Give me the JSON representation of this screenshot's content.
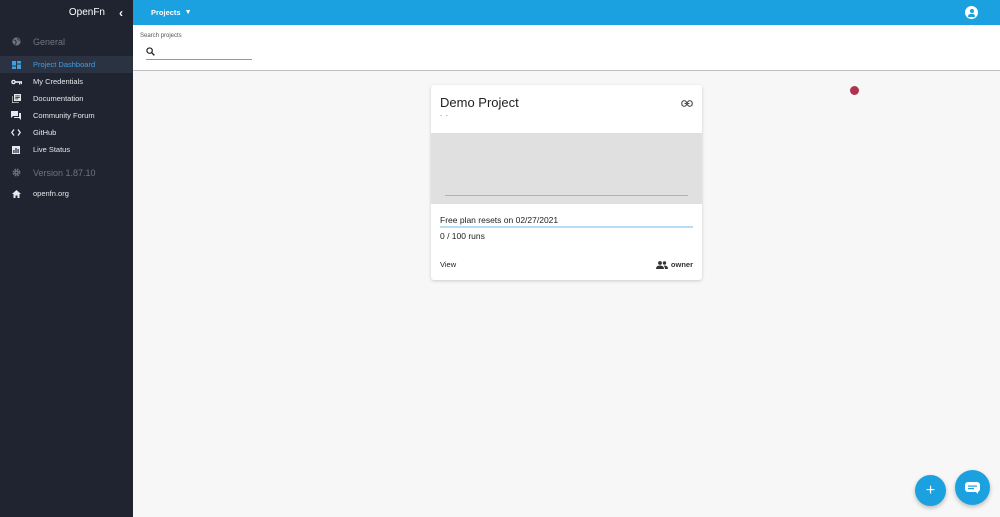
{
  "sidebar": {
    "brand": "OpenFn",
    "collapse_icon": "chevron-left-icon",
    "general_label": "General",
    "items": [
      {
        "label": "Project Dashboard",
        "icon": "dashboard-icon",
        "active": true
      },
      {
        "label": "My Credentials",
        "icon": "key-icon"
      },
      {
        "label": "Documentation",
        "icon": "book-icon"
      },
      {
        "label": "Community Forum",
        "icon": "forum-icon"
      },
      {
        "label": "GitHub",
        "icon": "code-icon"
      },
      {
        "label": "Live Status",
        "icon": "status-icon"
      }
    ],
    "version_label": "Version 1.87.10",
    "site_link": {
      "label": "openfn.org",
      "icon": "home-icon"
    }
  },
  "topbar": {
    "projects_label": "Projects",
    "account_icon": "account-circle-icon"
  },
  "search": {
    "label": "Search projects",
    "value": "",
    "icon": "search-icon"
  },
  "project_card": {
    "title": "Demo Project",
    "subtitle": "- -",
    "plan_text": "Free plan resets on 02/27/2021",
    "runs_text": "0 / 100 runs",
    "runs_used": 0,
    "runs_limit": 100,
    "view_label": "View",
    "role_label": "owner",
    "link_icon": "link-icon",
    "role_icon": "people-icon"
  },
  "fab": {
    "add_icon": "plus-icon",
    "add_symbol": "+",
    "chat_icon": "chat-icon"
  },
  "colors": {
    "accent": "#1ba1e0",
    "sidebar_bg": "#1f2430",
    "active_text": "#3da0e6",
    "indicator": "#b0334e"
  }
}
